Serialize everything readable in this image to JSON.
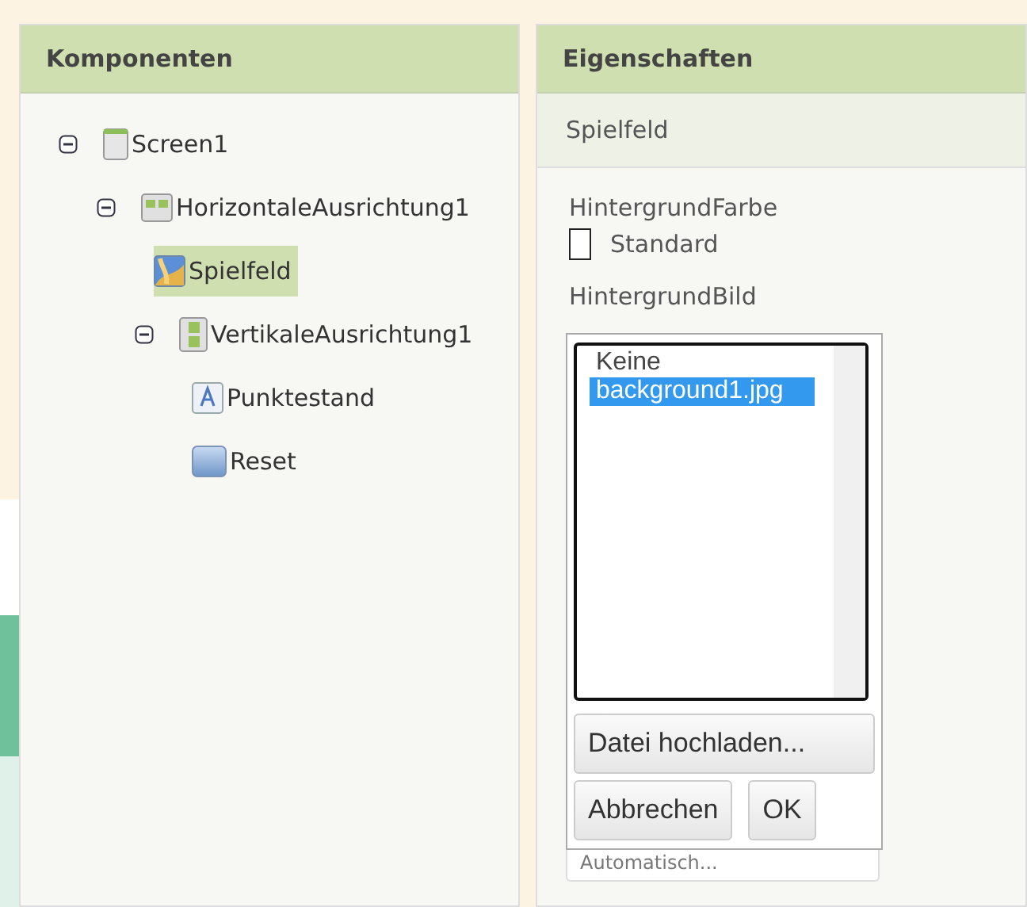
{
  "components": {
    "title": "Komponenten",
    "tree": [
      {
        "label": "Screen1",
        "kind": "screen",
        "selected": false,
        "expanded": true,
        "children": [
          {
            "label": "HorizontaleAusrichtung1",
            "kind": "horizontal",
            "selected": false,
            "expanded": true,
            "children": [
              {
                "label": "Spielfeld",
                "kind": "canvas",
                "selected": true
              },
              {
                "label": "VertikaleAusrichtung1",
                "kind": "vertical",
                "selected": false,
                "expanded": true,
                "children": [
                  {
                    "label": "Punktestand",
                    "kind": "label",
                    "selected": false
                  },
                  {
                    "label": "Reset",
                    "kind": "button",
                    "selected": false
                  }
                ]
              }
            ]
          }
        ]
      }
    ]
  },
  "properties": {
    "title": "Eigenschaften",
    "component": "Spielfeld",
    "color_property": {
      "label": "HintergrundFarbe",
      "value": "Standard",
      "color": "#ffffff"
    },
    "image_property": {
      "label": "HintergrundBild",
      "options": [
        {
          "label": "Keine",
          "selected": false
        },
        {
          "label": "background1.jpg",
          "selected": true
        }
      ],
      "upload_button": "Datei hochladen...",
      "cancel_button": "Abbrechen",
      "ok_button": "OK"
    },
    "next_field": {
      "value": "Automatisch..."
    }
  }
}
